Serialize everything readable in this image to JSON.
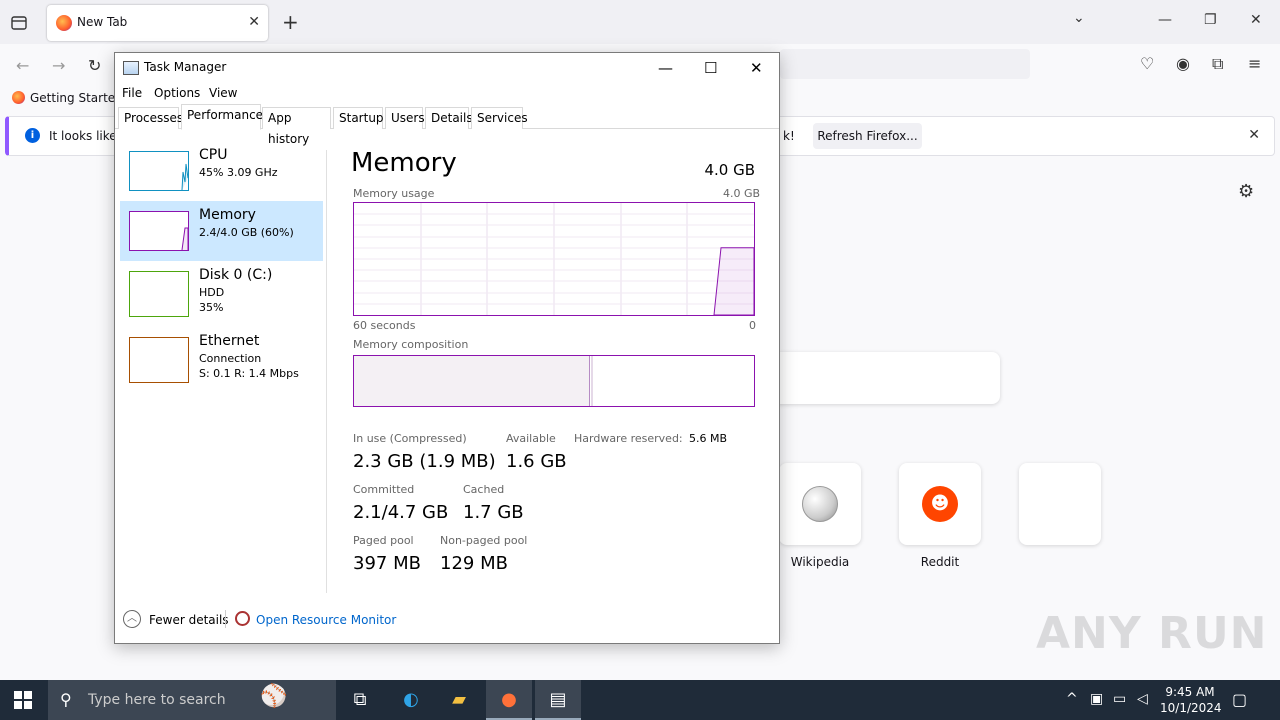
{
  "browser": {
    "tab_title": "New Tab",
    "bookmark_label": "Getting Started",
    "notice_text_start": "It looks like y",
    "notice_text_end": "k!",
    "notice_button": "Refresh Firefox...",
    "shortcuts": [
      {
        "label": "Wikipedia"
      },
      {
        "label": "Reddit"
      },
      {
        "label": ""
      }
    ]
  },
  "task_manager": {
    "window_title": "Task Manager",
    "menu": [
      "File",
      "Options",
      "View"
    ],
    "tabs": [
      "Processes",
      "Performance",
      "App history",
      "Startup",
      "Users",
      "Details",
      "Services"
    ],
    "active_tab": "Performance",
    "sidebar": [
      {
        "name": "CPU",
        "line1": "45%  3.09 GHz",
        "line2": "",
        "color": "#1191c1"
      },
      {
        "name": "Memory",
        "line1": "2.4/4.0 GB (60%)",
        "line2": "",
        "color": "#8b12ae"
      },
      {
        "name": "Disk 0 (C:)",
        "line1": "HDD",
        "line2": "35%",
        "color": "#4da60c"
      },
      {
        "name": "Ethernet",
        "line1": "Connection",
        "line2": "S: 0.1  R: 1.4 Mbps",
        "color": "#a74f01"
      }
    ],
    "memory": {
      "title": "Memory",
      "total": "4.0 GB",
      "usage_label": "Memory usage",
      "usage_max": "4.0 GB",
      "time_span": "60 seconds",
      "time_end": "0",
      "composition_label": "Memory composition",
      "in_use_fraction": 0.59,
      "usage_level_fraction": 0.6,
      "stats": {
        "in_use_label": "In use (Compressed)",
        "in_use_value": "2.3 GB (1.9 MB)",
        "available_label": "Available",
        "available_value": "1.6 GB",
        "hw_reserved_label": "Hardware reserved:",
        "hw_reserved_value": "5.6 MB",
        "committed_label": "Committed",
        "committed_value": "2.1/4.7 GB",
        "cached_label": "Cached",
        "cached_value": "1.7 GB",
        "paged_label": "Paged pool",
        "paged_value": "397 MB",
        "nonpaged_label": "Non-paged pool",
        "nonpaged_value": "129 MB"
      }
    },
    "footer": {
      "fewer_details": "Fewer details",
      "open_resource_monitor": "Open Resource Monitor"
    }
  },
  "taskbar": {
    "search_placeholder": "Type here to search",
    "time": "9:45 AM",
    "date": "10/1/2024"
  },
  "watermark": "ANY RUN"
}
